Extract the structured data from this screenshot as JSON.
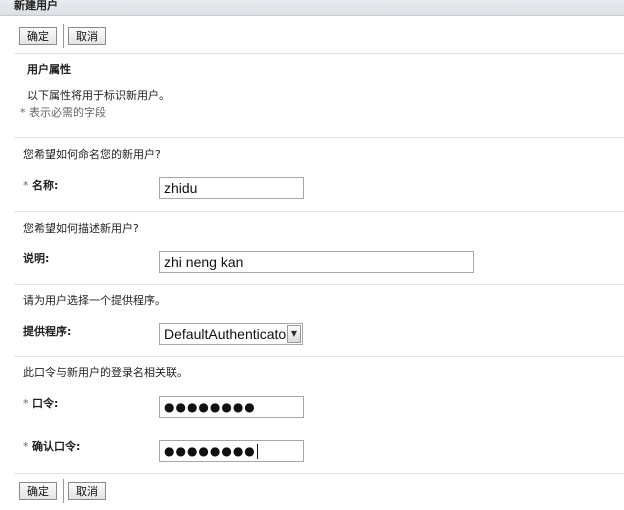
{
  "window": {
    "title": "新建用户"
  },
  "toolbar": {
    "ok_label": "确定",
    "cancel_label": "取消"
  },
  "section": {
    "title": "用户属性",
    "description": "以下属性将用于标识新用户。",
    "required_note": "* 表示必需的字段"
  },
  "name_section": {
    "prompt": "您希望如何命名您的新用户?",
    "required_marker": "*",
    "label": "名称:",
    "value": "zhidu"
  },
  "description_section": {
    "prompt": "您希望如何描述新用户?",
    "label": "说明:",
    "value": "zhi neng kan"
  },
  "provider_section": {
    "prompt": "请为用户选择一个提供程序。",
    "label": "提供程序:",
    "selected": "DefaultAuthenticator"
  },
  "password_section": {
    "prompt": "此口令与新用户的登录名相关联。",
    "required_marker": "*",
    "password_label": "口令:",
    "password_masked": "●●●●●●●●",
    "confirm_label": "确认口令:",
    "confirm_masked": "●●●●●●●●"
  }
}
